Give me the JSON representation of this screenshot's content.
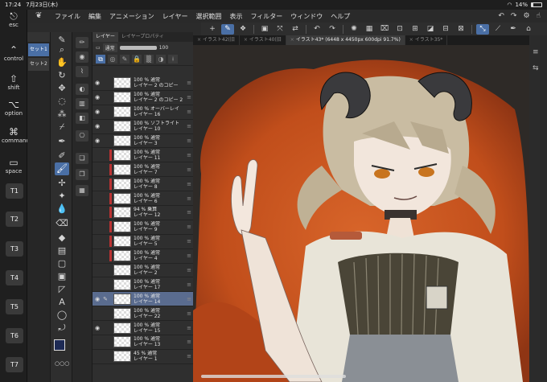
{
  "status": {
    "time": "17:24",
    "date": "7月23日(木)",
    "battery": "14%",
    "battery_level": 0.14
  },
  "menubar": {
    "items": [
      "ファイル",
      "編集",
      "アニメーション",
      "レイヤー",
      "選択範囲",
      "表示",
      "フィルター",
      "ウィンドウ",
      "ヘルプ"
    ]
  },
  "keys": {
    "esc": "esc",
    "control": "control",
    "shift": "shift",
    "option": "option",
    "command": "command",
    "space": "space",
    "t_keys": [
      "T1",
      "T2",
      "T3",
      "T4",
      "T5",
      "T6",
      "T7"
    ]
  },
  "subtool": {
    "header": "",
    "sets": [
      "セット1",
      "セット2"
    ]
  },
  "tabs": [
    {
      "label": "イラスト42(旧",
      "active": false
    },
    {
      "label": "イラスト40(旧",
      "active": false
    },
    {
      "label": "イラスト43* (6448 x 4450px 600dpi 91.7%)",
      "active": true
    },
    {
      "label": "イラスト35*",
      "active": false
    }
  ],
  "layer_panel": {
    "tabs": [
      "レイヤー",
      "レイヤープロパティ"
    ],
    "blend": "通常",
    "opacity": "100",
    "opacity_level": 1.0
  },
  "layers": [
    {
      "p": "100 % 通常",
      "n": "レイヤー 2 のコピー",
      "eye": true,
      "clip": false,
      "sel": false
    },
    {
      "p": "100 % 通常",
      "n": "レイヤー 2 のコピー 2",
      "eye": true,
      "clip": false,
      "sel": false
    },
    {
      "p": "100 % オーバーレイ",
      "n": "レイヤー 16",
      "eye": true,
      "clip": false,
      "sel": false
    },
    {
      "p": "100 % ソフトライト",
      "n": "レイヤー 10",
      "eye": true,
      "clip": false,
      "sel": false
    },
    {
      "p": "100 % 通常",
      "n": "レイヤー 3",
      "eye": true,
      "clip": false,
      "sel": false
    },
    {
      "p": "100 % 通常",
      "n": "レイヤー 11",
      "eye": false,
      "clip": true,
      "sel": false
    },
    {
      "p": "100 % 通常",
      "n": "レイヤー 7",
      "eye": false,
      "clip": true,
      "sel": false
    },
    {
      "p": "100 % 通常",
      "n": "レイヤー 8",
      "eye": false,
      "clip": true,
      "sel": false
    },
    {
      "p": "100 % 通常",
      "n": "レイヤー 6",
      "eye": false,
      "clip": true,
      "sel": false
    },
    {
      "p": "94 % 乗算",
      "n": "レイヤー 12",
      "eye": false,
      "clip": true,
      "sel": false
    },
    {
      "p": "100 % 通常",
      "n": "レイヤー 9",
      "eye": false,
      "clip": true,
      "sel": false
    },
    {
      "p": "100 % 通常",
      "n": "レイヤー 5",
      "eye": false,
      "clip": true,
      "sel": false
    },
    {
      "p": "100 % 通常",
      "n": "レイヤー 4",
      "eye": false,
      "clip": true,
      "sel": false
    },
    {
      "p": "100 % 通常",
      "n": "レイヤー 2",
      "eye": false,
      "clip": false,
      "sel": false
    },
    {
      "p": "100 % 通常",
      "n": "レイヤー 17",
      "eye": false,
      "clip": false,
      "sel": false
    },
    {
      "p": "100 % 通常",
      "n": "レイヤー 14",
      "eye": true,
      "clip": false,
      "sel": true
    },
    {
      "p": "100 % 通常",
      "n": "レイヤー 22",
      "eye": false,
      "clip": false,
      "sel": false
    },
    {
      "p": "100 % 通常",
      "n": "レイヤー 15",
      "eye": true,
      "clip": false,
      "sel": false
    },
    {
      "p": "100 % 通常",
      "n": "レイヤー 13",
      "eye": false,
      "clip": false,
      "sel": false
    },
    {
      "p": "45 % 通常",
      "n": "レイヤー 1",
      "eye": false,
      "clip": false,
      "sel": false
    }
  ],
  "colors": {
    "accent": "#4a6fa5",
    "main_color": "#1d2a55",
    "sub_color": "#e8d3c0",
    "canvas_bg": "#c8501c"
  }
}
